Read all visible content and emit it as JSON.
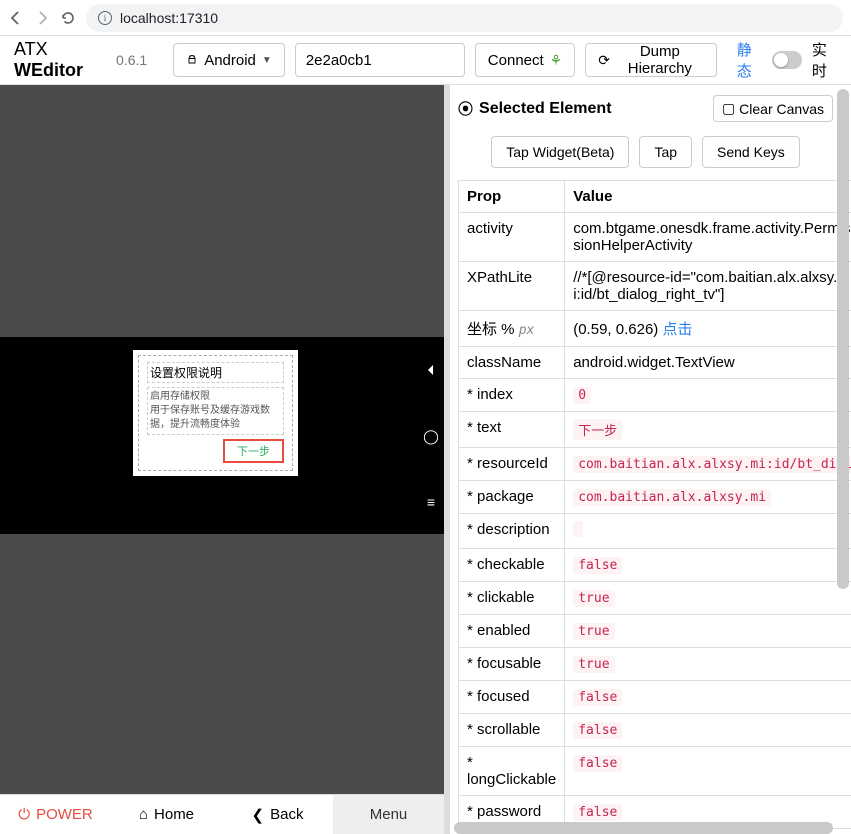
{
  "browser": {
    "url": "localhost:17310"
  },
  "toolbar": {
    "brand_prefix": "ATX ",
    "brand_main": "WEditor",
    "version": "0.6.1",
    "platform": "Android",
    "device": "2e2a0cb1",
    "connect": "Connect",
    "dump": "Dump Hierarchy",
    "static": "静态",
    "realtime": "实时"
  },
  "dialog": {
    "title": "设置权限说明",
    "line1": "启用存储权限",
    "line2": "用于保存账号及缓存游戏数据，提升流畅度体验",
    "button": "下一步"
  },
  "bottom": {
    "power": "POWER",
    "home": "Home",
    "back": "Back",
    "menu": "Menu"
  },
  "panel": {
    "title": "Selected Element",
    "clear": "Clear Canvas",
    "tap_widget": "Tap Widget(Beta)",
    "tap": "Tap",
    "send_keys": "Send Keys",
    "th_prop": "Prop",
    "th_value": "Value"
  },
  "props": {
    "activity_k": "activity",
    "activity_v": "com.btgame.onesdk.frame.activity.PermissionHelperActivity",
    "xpath_k": "XPathLite",
    "xpath_v": "//*[@resource-id=\"com.baitian.alx.alxsy.mi:id/bt_dialog_right_tv\"]",
    "coord_k": "坐标 % ",
    "coord_px": "px",
    "coord_v": "(0.59, 0.626) ",
    "coord_link": "点击",
    "class_k": "className",
    "class_v": "android.widget.TextView",
    "index_k": "* index",
    "index_v": "0",
    "text_k": "* text",
    "text_v": "下一步",
    "rid_k": "* resourceId",
    "rid_v": "com.baitian.alx.alxsy.mi:id/bt_dial",
    "pkg_k": "* package",
    "pkg_v": "com.baitian.alx.alxsy.mi",
    "desc_k": "* description",
    "checkable_k": "* checkable",
    "checkable_v": "false",
    "clickable_k": "* clickable",
    "clickable_v": "true",
    "enabled_k": "* enabled",
    "enabled_v": "true",
    "focusable_k": "* focusable",
    "focusable_v": "true",
    "focused_k": "* focused",
    "focused_v": "false",
    "scrollable_k": "* scrollable",
    "scrollable_v": "false",
    "longclick_k": "* longClickable",
    "longclick_v": "false",
    "password_k": "* password",
    "password_v": "false"
  }
}
